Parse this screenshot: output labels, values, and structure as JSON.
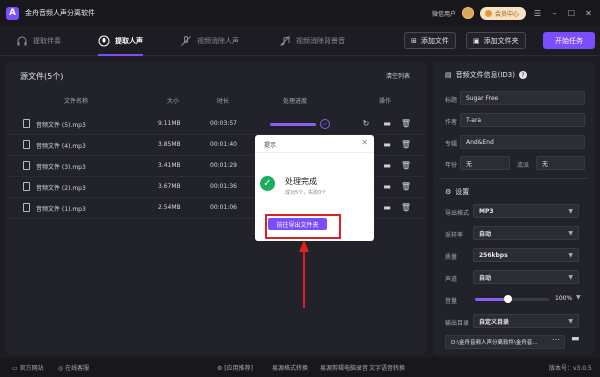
{
  "app": {
    "title": "金舟音频人声分离软件",
    "logo_letter": "A"
  },
  "titlebar": {
    "user": "微信用户",
    "vip_label": "会员中心"
  },
  "nav": {
    "tabs": [
      {
        "label": "提取伴奏",
        "active": false
      },
      {
        "label": "提取人声",
        "active": true
      },
      {
        "label": "视频消除人声",
        "active": false
      },
      {
        "label": "视频消除背景音",
        "active": false
      }
    ],
    "add_file": "添加文件",
    "add_folder": "添加文件夹",
    "start": "开始任务"
  },
  "source": {
    "title": "源文件(5个)",
    "clear": "清空列表",
    "headers": {
      "name": "文件名称",
      "size": "大小",
      "duration": "时长",
      "progress": "处理进度",
      "actions": "操作"
    },
    "rows": [
      {
        "name": "音频文件 (5).mp3",
        "size": "9.11MB",
        "duration": "00:03:57",
        "progress": 1.0
      },
      {
        "name": "音频文件 (4).mp3",
        "size": "3.85MB",
        "duration": "00:01:40",
        "progress": 1.0
      },
      {
        "name": "音频文件 (3).mp3",
        "size": "3.41MB",
        "duration": "00:01:29",
        "progress": 1.0
      },
      {
        "name": "音频文件 (2).mp3",
        "size": "3.67MB",
        "duration": "00:01:36",
        "progress": 1.0
      },
      {
        "name": "音频文件 (1).mp3",
        "size": "2.54MB",
        "duration": "00:01:06",
        "progress": 1.0
      }
    ]
  },
  "id3": {
    "title": "音频文件信息(ID3)",
    "title_label": "标题",
    "title_value": "Sugar Free",
    "author_label": "作者",
    "author_value": "T-ara",
    "album_label": "专辑",
    "album_value": "And&End",
    "year_label": "年份",
    "year_value": "无",
    "genre_label": "流派",
    "genre_value": "无"
  },
  "settings": {
    "title": "设置",
    "format_label": "导出格式",
    "format_value": "MP3",
    "samplerate_label": "采样率",
    "samplerate_value": "自动",
    "quality_label": "质量",
    "quality_value": "256kbps",
    "channel_label": "声道",
    "channel_value": "自动",
    "volume_label": "音量",
    "volume_value": "100%",
    "volume_level": 0.45,
    "output_label": "输出目录",
    "output_value": "自定义目录",
    "path_value": "D:\\金舟音频人声分离软件\\金舟音…"
  },
  "footer": {
    "website": "官方网站",
    "support": "在线客服",
    "apps_label": "[应用推荐]",
    "app1": "易源格式转换",
    "app2": "易源剪辑",
    "app3": "电脑录音",
    "app4": "文字语音转换",
    "version": "版本号：v3.0.5"
  },
  "dialog": {
    "title": "提示",
    "status": "处理完成",
    "summary": "成功5个，失败0个",
    "button": "前往导出文件夹"
  },
  "colors": {
    "accent": "#7b4dff",
    "success": "#1aad5c",
    "highlight": "#e02020"
  }
}
